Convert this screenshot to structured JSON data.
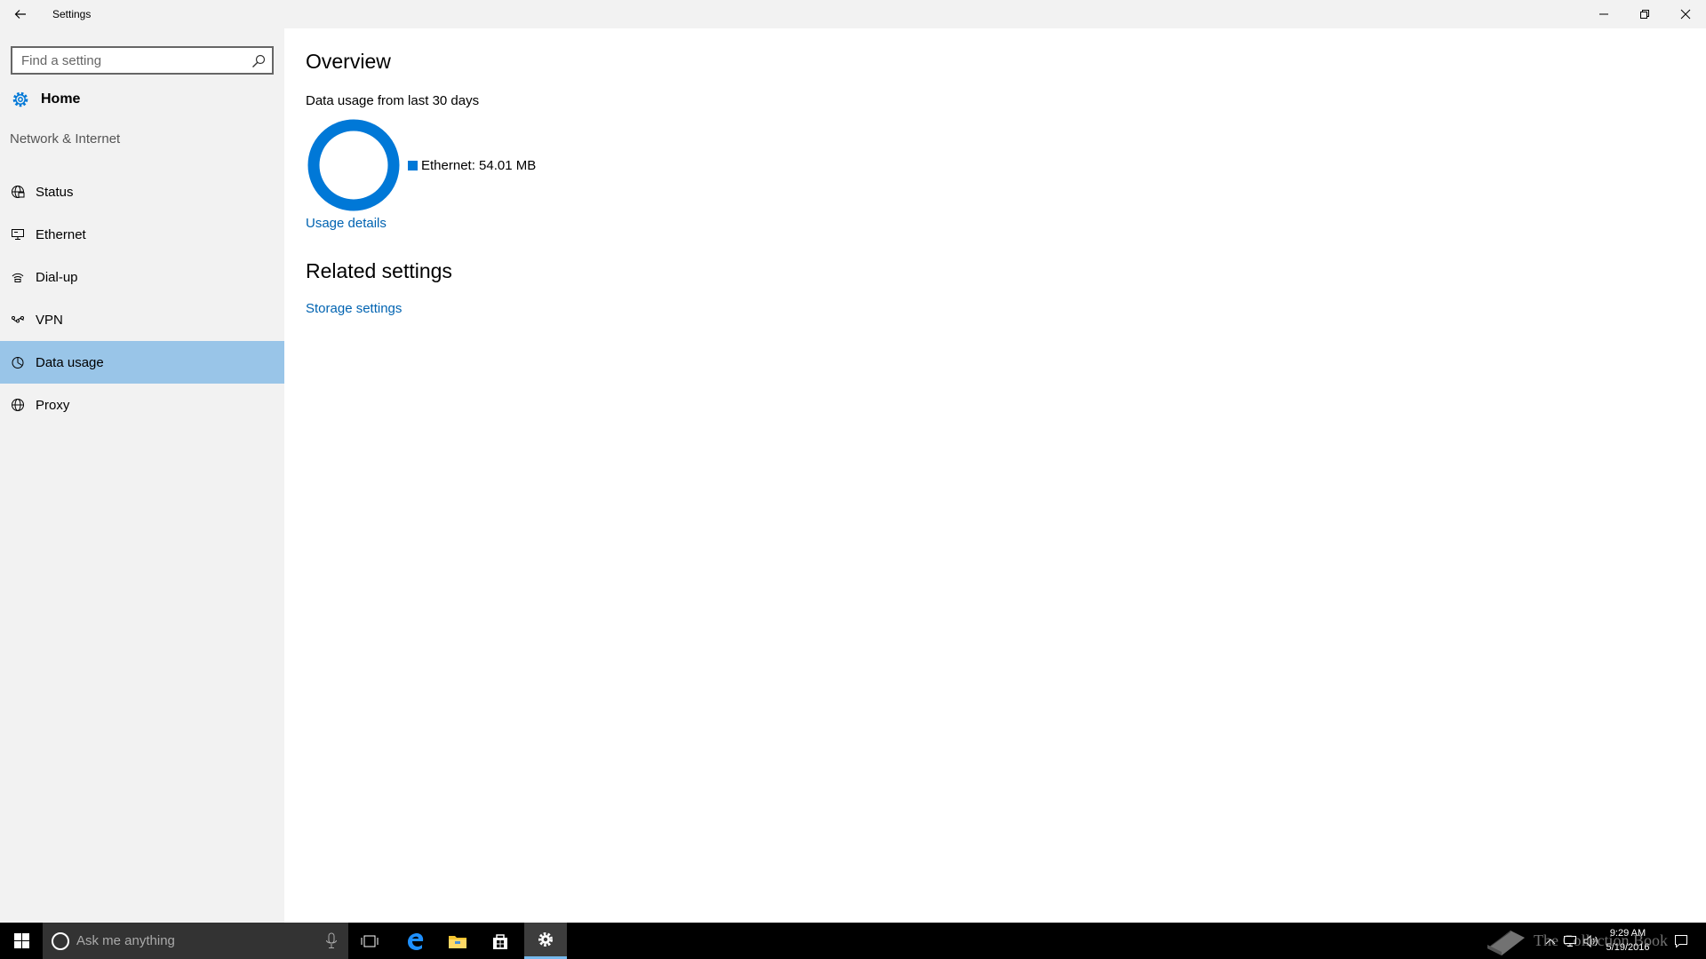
{
  "window": {
    "title": "Settings"
  },
  "sidebar": {
    "search_placeholder": "Find a setting",
    "home_label": "Home",
    "section_label": "Network & Internet",
    "items": [
      {
        "label": "Status",
        "icon": "status-globe-icon"
      },
      {
        "label": "Ethernet",
        "icon": "ethernet-icon"
      },
      {
        "label": "Dial-up",
        "icon": "dial-up-icon"
      },
      {
        "label": "VPN",
        "icon": "vpn-icon"
      },
      {
        "label": "Data usage",
        "icon": "data-usage-icon",
        "selected": true
      },
      {
        "label": "Proxy",
        "icon": "proxy-globe-icon"
      }
    ]
  },
  "main": {
    "overview_title": "Overview",
    "usage_subtitle": "Data usage from last 30 days",
    "usage_details_link": "Usage details",
    "related_title": "Related settings",
    "storage_link": "Storage settings"
  },
  "chart_data": {
    "type": "pie",
    "style": "donut",
    "categories": [
      "Ethernet"
    ],
    "values": [
      54.01
    ],
    "legend_labels": [
      "Ethernet: 54.01 MB"
    ],
    "colors": [
      "#0078d7"
    ],
    "legend_placement": "right"
  },
  "taskbar": {
    "search_placeholder": "Ask me anything",
    "time": "9:29 AM",
    "date": "5/19/2016",
    "watermark": "The Collection Book"
  },
  "colors": {
    "accent": "#0078d7",
    "link": "#0063b1",
    "selected_bg": "#99c5e8",
    "sidebar_bg": "#f2f2f2"
  }
}
